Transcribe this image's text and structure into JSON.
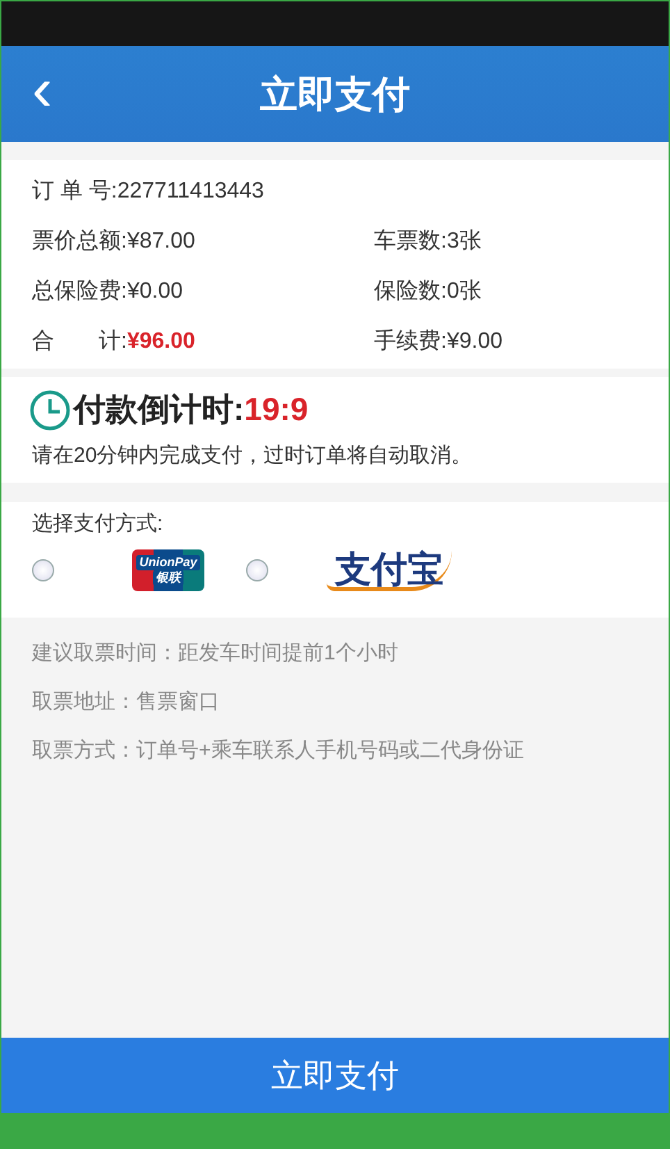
{
  "header": {
    "back_icon": "‹",
    "title": "立即支付"
  },
  "order": {
    "number": {
      "label": "订 单 号:",
      "value": "227711413443"
    },
    "rows": [
      {
        "left": {
          "label": "票价总额:",
          "value": "¥87.00",
          "highlight": false
        },
        "right": {
          "label": "车票数:",
          "value": "3张"
        }
      },
      {
        "left": {
          "label": "总保险费:",
          "value": "¥0.00",
          "highlight": false
        },
        "right": {
          "label": "保险数:",
          "value": "0张"
        }
      },
      {
        "left": {
          "label": "合　　计:",
          "value": "¥96.00",
          "highlight": true
        },
        "right": {
          "label": "手续费:",
          "value": "¥9.00"
        }
      }
    ]
  },
  "countdown": {
    "label": "付款倒计时:",
    "time": "19:9",
    "notice": "请在20分钟内完成支付，过时订单将自动取消。"
  },
  "payment": {
    "title": "选择支付方式:",
    "methods": [
      {
        "kind": "unionpay",
        "selected": false,
        "logo_text": [
          "UnionPay",
          "银联"
        ]
      },
      {
        "kind": "alipay",
        "selected": false,
        "logo_text": [
          "支付宝"
        ]
      }
    ]
  },
  "info": [
    "建议取票时间：距发车时间提前1个小时",
    "取票地址：售票窗口",
    "取票方式：订单号+乘车联系人手机号码或二代身份证"
  ],
  "pay_button": "立即支付"
}
